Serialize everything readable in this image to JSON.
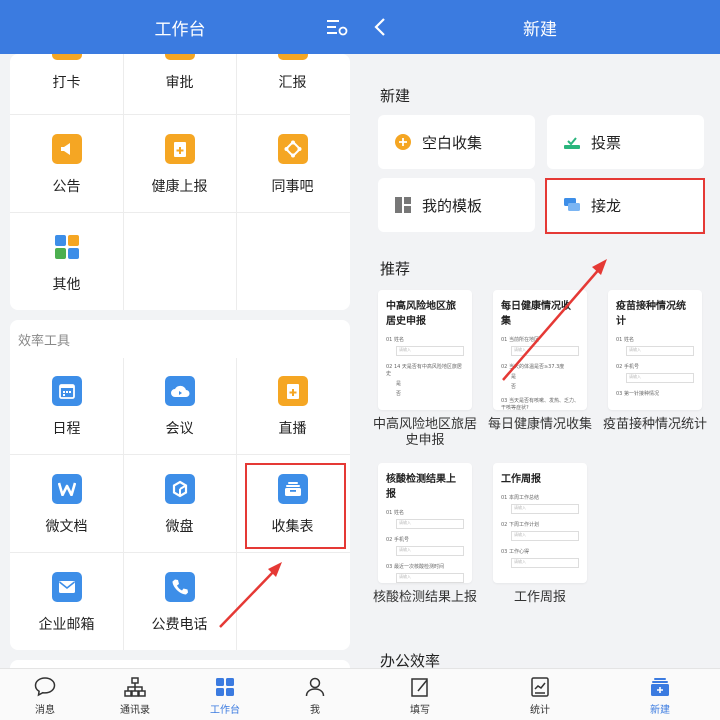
{
  "left": {
    "title": "工作台",
    "top_items": [
      {
        "label": "打卡"
      },
      {
        "label": "审批"
      },
      {
        "label": "汇报"
      },
      {
        "label": "公告"
      },
      {
        "label": "健康上报"
      },
      {
        "label": "同事吧"
      },
      {
        "label": "其他"
      }
    ],
    "tools_section": "效率工具",
    "tool_items": [
      {
        "label": "日程"
      },
      {
        "label": "会议"
      },
      {
        "label": "直播"
      },
      {
        "label": "微文档"
      },
      {
        "label": "微盘"
      },
      {
        "label": "收集表"
      },
      {
        "label": "企业邮箱"
      },
      {
        "label": "公费电话"
      }
    ],
    "tabs": [
      {
        "label": "消息"
      },
      {
        "label": "通讯录"
      },
      {
        "label": "工作台"
      },
      {
        "label": "我"
      }
    ]
  },
  "right": {
    "title": "新建",
    "new_section": "新建",
    "new_items": [
      {
        "label": "空白收集"
      },
      {
        "label": "投票"
      },
      {
        "label": "我的模板"
      },
      {
        "label": "接龙"
      }
    ],
    "rec_section": "推荐",
    "templates": [
      {
        "title": "中高风险地区旅居史申报",
        "caption": "中高风险地区旅居史申报",
        "q1": "01 姓名",
        "q2": "02 14 天是否有中高风险地区旅居史",
        "opt1": "是",
        "opt2": "否"
      },
      {
        "title": "每日健康情况收集",
        "caption": "每日健康情况收集",
        "q1": "01 当前所在地区",
        "q2": "02 当天的体温是否≥37.3度",
        "opt1": "是",
        "opt2": "否",
        "q3": "03 当天是否有咳嗽、发热、乏力、干咳等症状?"
      },
      {
        "title": "疫苗接种情况统计",
        "caption": "疫苗接种情况统计",
        "q1": "01 姓名",
        "q2": "02 手机号",
        "q3": "03 第一针接种情况"
      },
      {
        "title": "核酸检测结果上报",
        "caption": "核酸检测结果上报",
        "q1": "01 姓名",
        "q2": "02 手机号",
        "q3": "03 最近一次核酸检测时间"
      },
      {
        "title": "工作周报",
        "caption": "工作周报",
        "q1": "01 本周工作总结",
        "q2": "02 下周工作计划",
        "q3": "03 工作心得"
      }
    ],
    "input_placeholder": "请输入",
    "office_section": "办公效率",
    "tabs": [
      {
        "label": "填写"
      },
      {
        "label": "统计"
      },
      {
        "label": "新建"
      }
    ]
  },
  "colors": {
    "header_blue": "#3b7be0",
    "icon_orange": "#f5a623",
    "icon_blue": "#3d8ee8",
    "highlight_red": "#e53935"
  }
}
